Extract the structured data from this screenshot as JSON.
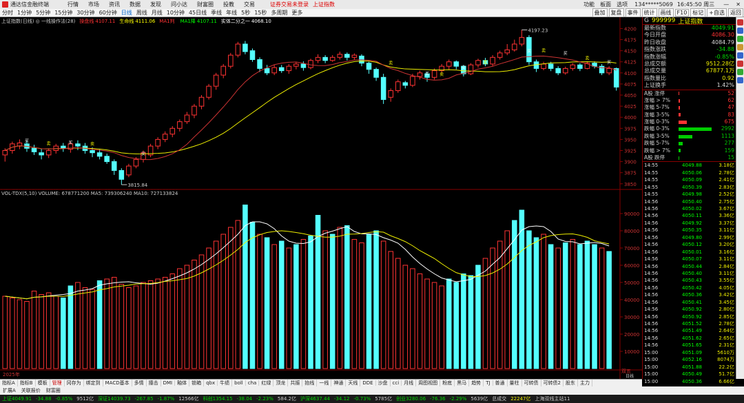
{
  "app": {
    "title": "通达信金融终端",
    "menu": [
      "行情",
      "市场",
      "资讯",
      "数据",
      "发现",
      "问小达",
      "财富圈",
      "投教",
      "交易"
    ],
    "notice": "证券交易未登录",
    "notice2": "上证指数",
    "right": [
      "功能",
      "板面",
      "选项"
    ],
    "account": "134*****5069",
    "time": "16:45:50 周三"
  },
  "toolbar": {
    "items": [
      "分时",
      "1分钟",
      "5分钟",
      "15分钟",
      "30分钟",
      "60分钟",
      "日线",
      "周线",
      "月线",
      "10分钟",
      "45日线",
      "季线",
      "年线",
      "5秒",
      "15秒",
      "多周期",
      "更多"
    ],
    "active": "日线",
    "buttons": [
      "叠加",
      "复盘",
      "事件",
      "统计",
      "画线",
      "F10",
      "标记",
      "+自选",
      "返回"
    ]
  },
  "chart": {
    "legend_main": "上证指数(日线) ◎  一线操作法(28)",
    "legend_items": [
      {
        "label": "操盘线",
        "value": "4107.11",
        "color": "#ff3333"
      },
      {
        "label": "生命线",
        "value": "4111.06",
        "color": "#ffff00"
      },
      {
        "label": "MA1判",
        "value": "",
        "color": "#ff3333"
      },
      {
        "label": "MA1降",
        "value": "4107.11",
        "color": "#00ff00"
      },
      {
        "label": "实体二分之一",
        "value": "4068.10",
        "color": "#ffffff"
      }
    ],
    "legend_vol": "VOL-TDX(5,10) VOLUME: 678771200  MA5: 739306240  MA10: 727133824",
    "high_label": "4197.23",
    "low_label": "3815.84",
    "buy_label": "买",
    "sell_label": "卖",
    "yearmark": "2025年",
    "rightmark": "双五",
    "rightmark2": "日线"
  },
  "chart_data": {
    "type": "candlestick",
    "price_ylim": [
      3845,
      4210
    ],
    "volume_ylim": [
      0,
      98000
    ],
    "price_ticks": [
      4200,
      4175,
      4150,
      4125,
      4100,
      4075,
      4050,
      4025,
      4000,
      3975,
      3950,
      3925,
      3900,
      3875,
      3850
    ],
    "volume_ticks": [
      90000,
      80000,
      70000,
      60000,
      50000,
      40000,
      30000,
      20000,
      10000
    ],
    "candles": [
      [
        3915,
        3925,
        3900,
        3930
      ],
      [
        3925,
        3940,
        3918,
        3945
      ],
      [
        3935,
        3942,
        3928,
        3950
      ],
      [
        3940,
        3930,
        3922,
        3948
      ],
      [
        3930,
        3922,
        3915,
        3938
      ],
      [
        3920,
        3915,
        3905,
        3928
      ],
      [
        3915,
        3925,
        3908,
        3930
      ],
      [
        3925,
        3935,
        3918,
        3940
      ],
      [
        3935,
        3930,
        3922,
        3942
      ],
      [
        3928,
        3940,
        3920,
        3945
      ],
      [
        3940,
        3935,
        3926,
        3948
      ],
      [
        3935,
        3925,
        3918,
        3942
      ],
      [
        3925,
        3920,
        3910,
        3932
      ],
      [
        3920,
        3912,
        3905,
        3928
      ],
      [
        3912,
        3900,
        3895,
        3918
      ],
      [
        3900,
        3880,
        3870,
        3905
      ],
      [
        3880,
        3860,
        3848,
        3885
      ],
      [
        3870,
        3890,
        3865,
        3895
      ],
      [
        3890,
        3905,
        3885,
        3910
      ],
      [
        3905,
        3920,
        3898,
        3925
      ],
      [
        3915,
        3935,
        3910,
        3940
      ],
      [
        3935,
        3950,
        3928,
        3955
      ],
      [
        3950,
        3962,
        3944,
        3968
      ],
      [
        3962,
        3975,
        3955,
        3980
      ],
      [
        3975,
        3990,
        3968,
        3995
      ],
      [
        3990,
        4005,
        3985,
        4012
      ],
      [
        4005,
        4025,
        3998,
        4030
      ],
      [
        4025,
        4045,
        4018,
        4050
      ],
      [
        4045,
        4070,
        4040,
        4075
      ],
      [
        4070,
        4095,
        4062,
        4100
      ],
      [
        4095,
        4115,
        4088,
        4120
      ],
      [
        4115,
        4140,
        4110,
        4145
      ],
      [
        4140,
        4165,
        4135,
        4170
      ],
      [
        4165,
        4148,
        4142,
        4172
      ],
      [
        4150,
        4130,
        4125,
        4155
      ],
      [
        4130,
        4110,
        4102,
        4135
      ],
      [
        4110,
        4100,
        4095,
        4118
      ],
      [
        4100,
        4112,
        4095,
        4118
      ],
      [
        4112,
        4105,
        4100,
        4118
      ],
      [
        4105,
        4115,
        4098,
        4120
      ],
      [
        4115,
        4120,
        4108,
        4125
      ],
      [
        4120,
        4112,
        4105,
        4126
      ],
      [
        4112,
        4128,
        4108,
        4132
      ],
      [
        4128,
        4135,
        4122,
        4142
      ],
      [
        4135,
        4128,
        4122,
        4140
      ],
      [
        4128,
        4135,
        4125,
        4140
      ],
      [
        4135,
        4142,
        4130,
        4148
      ],
      [
        4142,
        4135,
        4128,
        4146
      ],
      [
        4135,
        4140,
        4130,
        4144
      ],
      [
        4138,
        4122,
        4115,
        4142
      ],
      [
        4122,
        4108,
        4098,
        4125
      ],
      [
        4108,
        4090,
        4082,
        4112
      ],
      [
        4090,
        4040,
        4030,
        4098
      ],
      [
        4045,
        4060,
        4035,
        4065
      ],
      [
        4060,
        4080,
        4055,
        4085
      ],
      [
        4078,
        4072,
        4065,
        4082
      ],
      [
        4072,
        4092,
        4068,
        4098
      ],
      [
        4092,
        4100,
        4085,
        4105
      ],
      [
        4098,
        4090,
        4080,
        4102
      ],
      [
        4090,
        4105,
        4085,
        4110
      ],
      [
        4105,
        4115,
        4100,
        4120
      ],
      [
        4115,
        4125,
        4108,
        4130
      ],
      [
        4125,
        4115,
        4108,
        4128
      ],
      [
        4115,
        4098,
        4092,
        4118
      ],
      [
        4098,
        4118,
        4095,
        4122
      ],
      [
        4118,
        4128,
        4112,
        4132
      ],
      [
        4128,
        4120,
        4115,
        4134
      ],
      [
        4120,
        4135,
        4115,
        4140
      ],
      [
        4135,
        4145,
        4130,
        4150
      ],
      [
        4145,
        4152,
        4140,
        4165
      ],
      [
        4152,
        4165,
        4148,
        4175
      ],
      [
        4165,
        4180,
        4160,
        4197
      ],
      [
        4180,
        4125,
        4118,
        4185
      ],
      [
        4125,
        4110,
        4102,
        4130
      ],
      [
        4110,
        4120,
        4106,
        4125
      ],
      [
        4120,
        4110,
        4104,
        4125
      ],
      [
        4110,
        4100,
        4095,
        4115
      ],
      [
        4100,
        4110,
        4096,
        4114
      ],
      [
        4110,
        4118,
        4105,
        4122
      ],
      [
        4118,
        4110,
        4104,
        4122
      ],
      [
        4110,
        4122,
        4108,
        4126
      ],
      [
        4122,
        4115,
        4110,
        4126
      ],
      [
        4115,
        4100,
        4095,
        4120
      ],
      [
        4100,
        4110,
        4095,
        4115
      ],
      [
        4110,
        4068,
        4060,
        4112
      ]
    ],
    "volumes": [
      [
        42000,
        1
      ],
      [
        41000,
        1
      ],
      [
        40000,
        1
      ],
      [
        39000,
        1
      ],
      [
        45000,
        1
      ],
      [
        43000,
        1
      ],
      [
        44000,
        1
      ],
      [
        42000,
        1
      ],
      [
        41000,
        0
      ],
      [
        48000,
        0
      ],
      [
        50000,
        1
      ],
      [
        47000,
        1
      ],
      [
        46000,
        1
      ],
      [
        51000,
        0
      ],
      [
        52000,
        1
      ],
      [
        53000,
        1
      ],
      [
        49000,
        1
      ],
      [
        47000,
        1
      ],
      [
        48000,
        1
      ],
      [
        50000,
        1
      ],
      [
        51000,
        1
      ],
      [
        52000,
        1
      ],
      [
        53000,
        1
      ],
      [
        55000,
        1
      ],
      [
        58000,
        1
      ],
      [
        60000,
        1
      ],
      [
        63000,
        1
      ],
      [
        66000,
        1
      ],
      [
        70000,
        1
      ],
      [
        74000,
        1
      ],
      [
        78000,
        1
      ],
      [
        82000,
        1
      ],
      [
        86000,
        1
      ],
      [
        95000,
        0
      ],
      [
        85000,
        0
      ],
      [
        78000,
        1
      ],
      [
        76000,
        0
      ],
      [
        72000,
        1
      ],
      [
        74000,
        0
      ],
      [
        70000,
        1
      ],
      [
        72000,
        0
      ],
      [
        75000,
        1
      ],
      [
        77000,
        0
      ],
      [
        89000,
        0
      ],
      [
        80000,
        1
      ],
      [
        78000,
        0
      ],
      [
        82000,
        1
      ],
      [
        83000,
        0
      ],
      [
        75000,
        1
      ],
      [
        73000,
        1
      ],
      [
        78000,
        0
      ],
      [
        80000,
        0
      ],
      [
        74000,
        1
      ],
      [
        68000,
        1
      ],
      [
        64000,
        1
      ],
      [
        60000,
        1
      ],
      [
        58000,
        1
      ],
      [
        55000,
        1
      ],
      [
        52000,
        1
      ],
      [
        50000,
        1
      ],
      [
        48000,
        1
      ],
      [
        52000,
        0
      ],
      [
        50000,
        0
      ],
      [
        55000,
        0
      ],
      [
        54000,
        0
      ],
      [
        60000,
        0
      ],
      [
        64000,
        1
      ],
      [
        70000,
        1
      ],
      [
        74000,
        1
      ],
      [
        80000,
        1
      ],
      [
        86000,
        0
      ],
      [
        92000,
        0
      ],
      [
        80000,
        0
      ],
      [
        76000,
        0
      ],
      [
        78000,
        1
      ],
      [
        72000,
        0
      ],
      [
        70000,
        1
      ],
      [
        73000,
        0
      ],
      [
        75000,
        1
      ],
      [
        72000,
        0
      ],
      [
        74000,
        0
      ],
      [
        72000,
        0
      ],
      [
        70000,
        1
      ],
      [
        68000,
        0
      ]
    ]
  },
  "quote": {
    "code": "999999",
    "name": "上证指数",
    "g": "G",
    "rows": [
      {
        "l": "最新指数",
        "v": "4049.91",
        "c": "dn"
      },
      {
        "l": "今日开盘",
        "v": "4086.30",
        "c": "up"
      },
      {
        "l": "昨日收盘",
        "v": "4084.79",
        "c": ""
      },
      {
        "l": "指数涨跌",
        "v": "-34.88",
        "c": "dn"
      },
      {
        "l": "指数涨幅",
        "v": "-0.85%",
        "c": "dn"
      },
      {
        "l": "总成交额",
        "v": "9512.28亿",
        "c": "yl"
      },
      {
        "l": "总成交量",
        "v": "67877.1万",
        "c": "yl"
      },
      {
        "l": "指数量比",
        "v": "0.92",
        "c": "yl"
      },
      {
        "l": "上证换手",
        "v": "1.42%",
        "c": ""
      }
    ],
    "dist": [
      {
        "l": "A股 涨停",
        "v": "52",
        "w": 1,
        "c": "#f33"
      },
      {
        "l": "涨幅 > 7%",
        "v": "62",
        "w": 2,
        "c": "#f33"
      },
      {
        "l": "涨幅 5-7%",
        "v": "47",
        "w": 2,
        "c": "#f33"
      },
      {
        "l": "涨幅 3-5%",
        "v": "83",
        "w": 3,
        "c": "#f33"
      },
      {
        "l": "涨幅 0-3%",
        "v": "675",
        "w": 12,
        "c": "#f33"
      },
      {
        "l": "跌幅 0-3%",
        "v": "2992",
        "w": 48,
        "c": "#0c0"
      },
      {
        "l": "跌幅 3-5%",
        "v": "1113",
        "w": 20,
        "c": "#0c0"
      },
      {
        "l": "跌幅 5-7%",
        "v": "277",
        "w": 6,
        "c": "#0c0"
      },
      {
        "l": "跌幅 > 7%",
        "v": "159",
        "w": 3,
        "c": "#0c0"
      },
      {
        "l": "A股 跌停",
        "v": "15",
        "w": 1,
        "c": "#0c0"
      }
    ],
    "ticks": [
      [
        "14:55",
        "4049.88",
        "3.18亿"
      ],
      [
        "14:55",
        "4050.06",
        "2.78亿"
      ],
      [
        "14:55",
        "4050.09",
        "2.41亿"
      ],
      [
        "14:55",
        "4050.39",
        "2.83亿"
      ],
      [
        "14:55",
        "4049.98",
        "2.52亿"
      ],
      [
        "14:56",
        "4050.40",
        "2.75亿"
      ],
      [
        "14:56",
        "4050.02",
        "3.67亿"
      ],
      [
        "14:56",
        "4050.11",
        "3.36亿"
      ],
      [
        "14:56",
        "4049.92",
        "3.37亿"
      ],
      [
        "14:56",
        "4050.35",
        "3.11亿"
      ],
      [
        "14:56",
        "4049.80",
        "2.99亿"
      ],
      [
        "14:56",
        "4050.12",
        "3.20亿"
      ],
      [
        "14:56",
        "4050.01",
        "3.16亿"
      ],
      [
        "14:56",
        "4050.07",
        "3.11亿"
      ],
      [
        "14:56",
        "4050.44",
        "2.84亿"
      ],
      [
        "14:56",
        "4050.40",
        "3.11亿"
      ],
      [
        "14:56",
        "4050.43",
        "3.55亿"
      ],
      [
        "14:56",
        "4050.42",
        "4.05亿"
      ],
      [
        "14:56",
        "4050.36",
        "3.42亿"
      ],
      [
        "14:56",
        "4050.41",
        "3.45亿"
      ],
      [
        "14:56",
        "4050.92",
        "2.80亿"
      ],
      [
        "14:56",
        "4050.92",
        "2.85亿"
      ],
      [
        "14:56",
        "4051.52",
        "2.78亿"
      ],
      [
        "14:56",
        "4051.49",
        "2.64亿"
      ],
      [
        "14:56",
        "4051.62",
        "2.65亿"
      ],
      [
        "14:56",
        "4051.65",
        "2.31亿"
      ],
      [
        "15:00",
        "4051.09",
        "5610万"
      ],
      [
        "15:00",
        "4052.16",
        "8074万"
      ],
      [
        "15:00",
        "4051.88",
        "22.2亿"
      ],
      [
        "15:00",
        "4050.49",
        "51.7亿"
      ],
      [
        "15:00",
        "4050.36",
        "6.66亿"
      ],
      [
        "15:00",
        "4049.91",
        "12.5亿"
      ]
    ]
  },
  "tabs": [
    "指标A",
    "指标B",
    "模板",
    "管理",
    "冈存为",
    "绑定到",
    "MACD基本",
    "多情",
    "撞击",
    "DMI",
    "釉体",
    "锁箱",
    "qbx",
    "牛绩",
    "boll",
    "cha",
    "红绿",
    "顶龙",
    "共振",
    "抬线",
    "一线",
    "神通",
    "天线",
    "DDE",
    "沙盘",
    "cci",
    "月线",
    "周图视图",
    "粉底",
    "黑马",
    "趋势",
    "TJ",
    "普通",
    "量柱",
    "可转债",
    "可转债2",
    "股东",
    "主力"
  ],
  "tabs_active": "管理",
  "subbar": [
    "扩展A",
    "关联报价",
    "财富圈"
  ],
  "status": {
    "items": [
      {
        "t": "上证4049.91",
        "c": "dn"
      },
      {
        "t": "-34.88",
        "c": "dn"
      },
      {
        "t": "-0.85%",
        "c": "dn"
      },
      {
        "t": "9512亿",
        "c": ""
      },
      {
        "t": "深证14039.73",
        "c": "dn"
      },
      {
        "t": "-267.85",
        "c": "dn"
      },
      {
        "t": "-1.87%",
        "c": "dn"
      },
      {
        "t": "12566亿",
        "c": ""
      },
      {
        "t": "科创1354.15",
        "c": "dn"
      },
      {
        "t": "-38.04",
        "c": "dn"
      },
      {
        "t": "-2.23%",
        "c": "dn"
      },
      {
        "t": "584.2亿",
        "c": ""
      },
      {
        "t": "沪深4637.44",
        "c": "dn"
      },
      {
        "t": "-34.12",
        "c": "dn"
      },
      {
        "t": "-0.73%",
        "c": "dn"
      },
      {
        "t": "5785亿",
        "c": ""
      },
      {
        "t": "创业3280.06",
        "c": "dn"
      },
      {
        "t": "-76.36",
        "c": "dn"
      },
      {
        "t": "-2.29%",
        "c": "dn"
      },
      {
        "t": "5639亿",
        "c": ""
      },
      {
        "t": "总成交",
        "c": ""
      },
      {
        "t": "22247亿",
        "c": "yl"
      },
      {
        "t": "上海双线主站11",
        "c": ""
      }
    ]
  }
}
